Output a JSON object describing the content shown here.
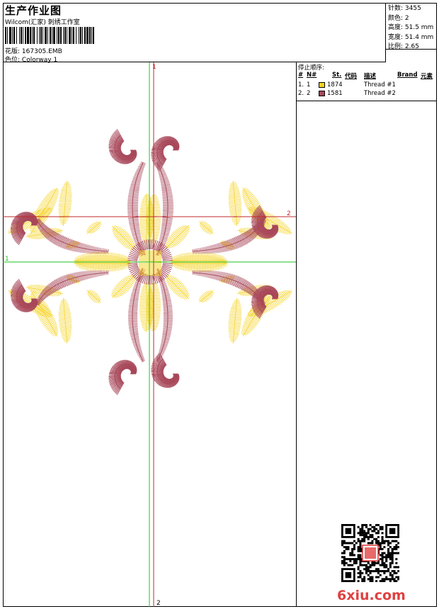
{
  "header": {
    "title": "生产作业图",
    "subtitle": "Wilcom(汇家) 刺绣工作室",
    "design_label": "花版:",
    "design_value": "167305.EMB",
    "color_label": "色位:",
    "color_value": "Colorway 1"
  },
  "stats": {
    "stitches": "针数: 3455",
    "colors": "颜色: 2",
    "height": "高度: 51.5 mm",
    "width": "宽度: 51.4 mm",
    "ratio": "比例: 2.65"
  },
  "stop_sequence": {
    "caption": "停止顺序:",
    "headers": [
      "#",
      "N#",
      "St.",
      "代码",
      "描述",
      "Brand",
      "元素"
    ],
    "rows": [
      {
        "num": "1.",
        "n": "1",
        "color": "#f5d21e",
        "code": "1874",
        "desc": "Thread #1"
      },
      {
        "num": "2.",
        "n": "2",
        "color": "#a8485a",
        "code": "1581",
        "desc": "Thread #2"
      }
    ]
  },
  "guides": {
    "red_top": "1",
    "red_right": "2",
    "green_left": "1",
    "green_bottom": "2"
  },
  "colors": {
    "thread1": "#f5d21e",
    "thread2": "#a8485a",
    "guide_red": "#c0282e",
    "guide_green": "#22c022"
  },
  "watermark": "6xiu.com"
}
